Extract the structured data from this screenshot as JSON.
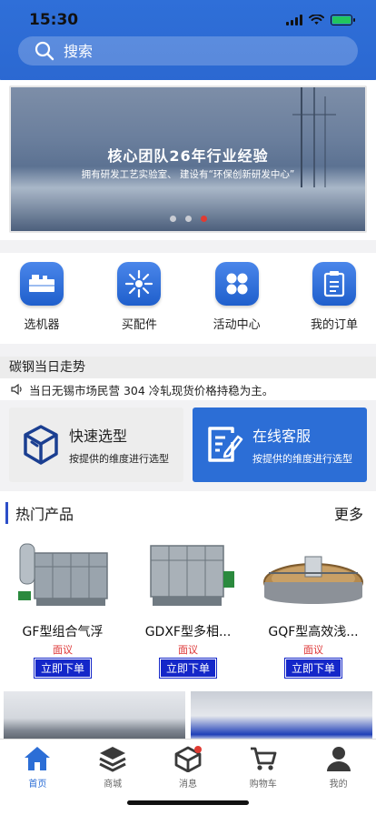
{
  "status": {
    "time": "15:30"
  },
  "search": {
    "placeholder": "搜索"
  },
  "banner": {
    "title": "核心团队26年行业经验",
    "subtitle": "拥有研发工艺实验室、 建设有“环保创新研发中心”"
  },
  "quick_nav": [
    {
      "label": "选机器",
      "icon": "machine-icon"
    },
    {
      "label": "买配件",
      "icon": "parts-icon"
    },
    {
      "label": "活动中心",
      "icon": "activity-icon"
    },
    {
      "label": "我的订单",
      "icon": "clipboard-icon"
    }
  ],
  "trend": {
    "heading": "碳钢当日走势",
    "text": "当日无锡市场民营 304 冷轧现货价格持稳为主。"
  },
  "cards": {
    "quick_select": {
      "title": "快速选型",
      "subtitle": "按提供的维度进行选型"
    },
    "online_service": {
      "title": "在线客服",
      "subtitle": "按提供的维度进行选型"
    }
  },
  "hot": {
    "title": "热门产品",
    "more": "更多",
    "products": [
      {
        "name": "GF型组合气浮",
        "price": "面议",
        "button": "立即下单"
      },
      {
        "name": "GDXF型多相...",
        "price": "面议",
        "button": "立即下单"
      },
      {
        "name": "GQF型高效浅...",
        "price": "面议",
        "button": "立即下单"
      }
    ]
  },
  "tabbar": [
    {
      "label": "首页",
      "icon": "home-icon"
    },
    {
      "label": "商城",
      "icon": "layers-icon"
    },
    {
      "label": "消息",
      "icon": "message-box-icon"
    },
    {
      "label": "购物车",
      "icon": "cart-icon"
    },
    {
      "label": "我的",
      "icon": "user-icon"
    }
  ],
  "colors": {
    "primary": "#2c6ed6",
    "buy_button": "#1427c9",
    "price": "#d33333",
    "active_dot": "#e03b32"
  }
}
